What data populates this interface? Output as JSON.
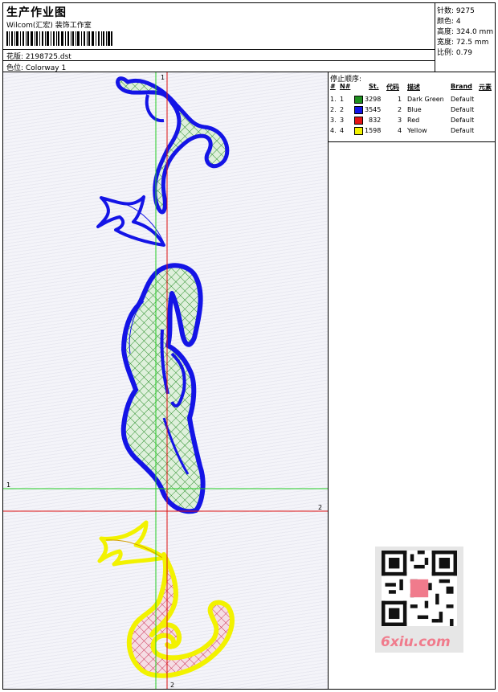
{
  "header": {
    "title": "生产作业图",
    "company": "Wilcom(汇宏) 装饰工作室",
    "design_label": "花版:",
    "design_value": "2198725.dst",
    "colorway_label": "色位:",
    "colorway_value": "Colorway 1"
  },
  "stats": [
    {
      "label": "针数:",
      "value": "9275"
    },
    {
      "label": "颜色:",
      "value": "4"
    },
    {
      "label": "高度:",
      "value": "324.0 mm"
    },
    {
      "label": "宽度:",
      "value": "72.5 mm"
    },
    {
      "label": "比例:",
      "value": "0.79"
    }
  ],
  "sequence": {
    "title": "停止顺序:",
    "columns": [
      "#",
      "N#",
      "St.",
      "代码",
      "描述",
      "Brand",
      "元素"
    ],
    "rows": [
      {
        "idx": "1.",
        "n": "1",
        "stitches": "3298",
        "code": "1",
        "desc": "Dark Green",
        "brand": "Default",
        "color": "#1e8f1e"
      },
      {
        "idx": "2.",
        "n": "2",
        "stitches": "3545",
        "code": "2",
        "desc": "Blue",
        "brand": "Default",
        "color": "#1414e6"
      },
      {
        "idx": "3.",
        "n": "3",
        "stitches": "832",
        "code": "3",
        "desc": "Red",
        "brand": "Default",
        "color": "#e61414"
      },
      {
        "idx": "4.",
        "n": "4",
        "stitches": "1598",
        "code": "4",
        "desc": "Yellow",
        "brand": "Default",
        "color": "#f2f200"
      }
    ]
  },
  "guides": {
    "top_marker": "1",
    "left_marker": "1",
    "right_marker": "2",
    "bottom_marker": "2"
  },
  "watermark": "6xiu.com",
  "colors": {
    "outline_blue": "#1414e6",
    "fill_green": "#1e8f1e",
    "outline_yellow": "#f2f200",
    "stitch_red": "#e61414",
    "guide_green": "#22cc22",
    "guide_red": "#dd1111"
  }
}
